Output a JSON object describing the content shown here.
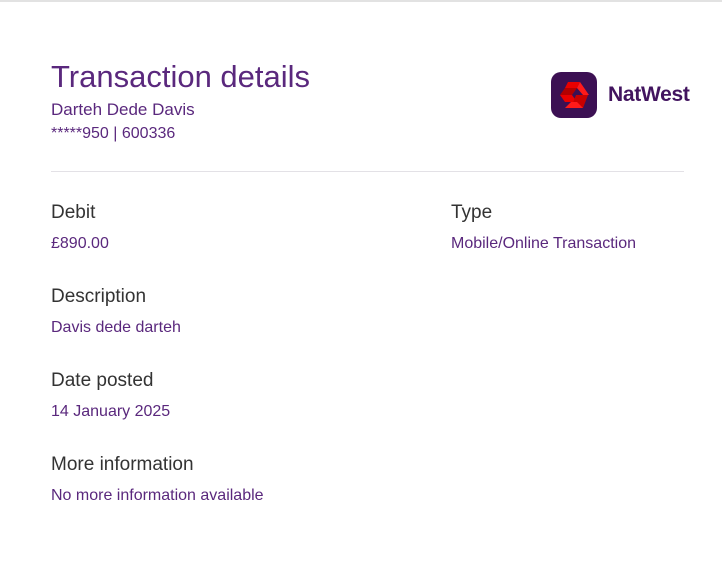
{
  "header": {
    "title": "Transaction details",
    "account_name": "Darteh Dede Davis",
    "account_number": "*****950  |  600336"
  },
  "logo": {
    "brand": "NatWest",
    "mark_color": "#3c1053",
    "cubes_color": "#e90000"
  },
  "fields": {
    "debit_label": "Debit",
    "debit_value": "£890.00",
    "type_label": "Type",
    "type_value": "Mobile/Online Transaction",
    "description_label": "Description",
    "description_value": "Davis dede darteh",
    "date_label": "Date posted",
    "date_value": "14 January 2025",
    "more_label": "More information",
    "more_value": "No more information available"
  },
  "colors": {
    "accent": "#5a287d",
    "label": "#333333",
    "divider": "#e3e1e6"
  }
}
